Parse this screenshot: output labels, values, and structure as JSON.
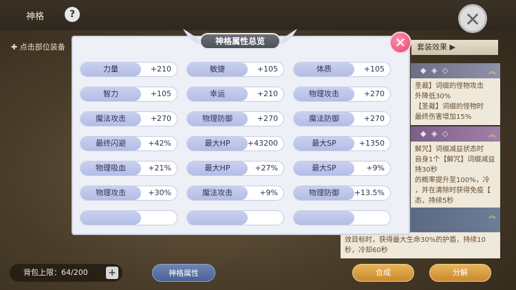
{
  "topbar": {
    "title": "神格"
  },
  "left": {
    "hint": "✚ 点击部位装备"
  },
  "suit": {
    "header": "套装效果 ▶"
  },
  "cards": {
    "card1_deco": "◆ ◈ ◇",
    "card1_text": "圣裁】词缀的怪物攻击\n外降低30%\n【圣裁】词缀的怪物时\n最终伤害增加15%",
    "card2_deco": "◆ ◈ ◇",
    "card2_text": "解咒】词缀减益状态时\n自身1个【解咒】词缀减益\n持30秒\n的概率提升至100%，冷\n，并在清除时获得免疫【\n态，持续5秒",
    "card3_text": "效目标时，获得最大生命30%的护盾，持续10秒，冷却60秒"
  },
  "bottom": {
    "bag_label": "背包上限：64/200",
    "attr_button": "神格属性",
    "synth_button": "合成",
    "decompose_button": "分解"
  },
  "modal": {
    "title": "神格属性总览",
    "close": "✕",
    "stats": [
      {
        "name": "力量",
        "value": "+210"
      },
      {
        "name": "敏捷",
        "value": "+105"
      },
      {
        "name": "体质",
        "value": "+105"
      },
      {
        "name": "智力",
        "value": "+105"
      },
      {
        "name": "幸运",
        "value": "+210"
      },
      {
        "name": "物理攻击",
        "value": "+270"
      },
      {
        "name": "魔法攻击",
        "value": "+270"
      },
      {
        "name": "物理防御",
        "value": "+270"
      },
      {
        "name": "魔法防御",
        "value": "+270"
      },
      {
        "name": "最终闪避",
        "value": "+42%"
      },
      {
        "name": "最大HP",
        "value": "+43200"
      },
      {
        "name": "最大SP",
        "value": "+1350"
      },
      {
        "name": "物理吸血",
        "value": "+21%"
      },
      {
        "name": "最大HP",
        "value": "+27%"
      },
      {
        "name": "最大SP",
        "value": "+9%"
      },
      {
        "name": "物理攻击",
        "value": "+30%"
      },
      {
        "name": "魔法攻击",
        "value": "+9%"
      },
      {
        "name": "物理防御",
        "value": "+13.5%"
      },
      {
        "name": "",
        "value": ""
      },
      {
        "name": "",
        "value": ""
      },
      {
        "name": "",
        "value": ""
      }
    ]
  }
}
